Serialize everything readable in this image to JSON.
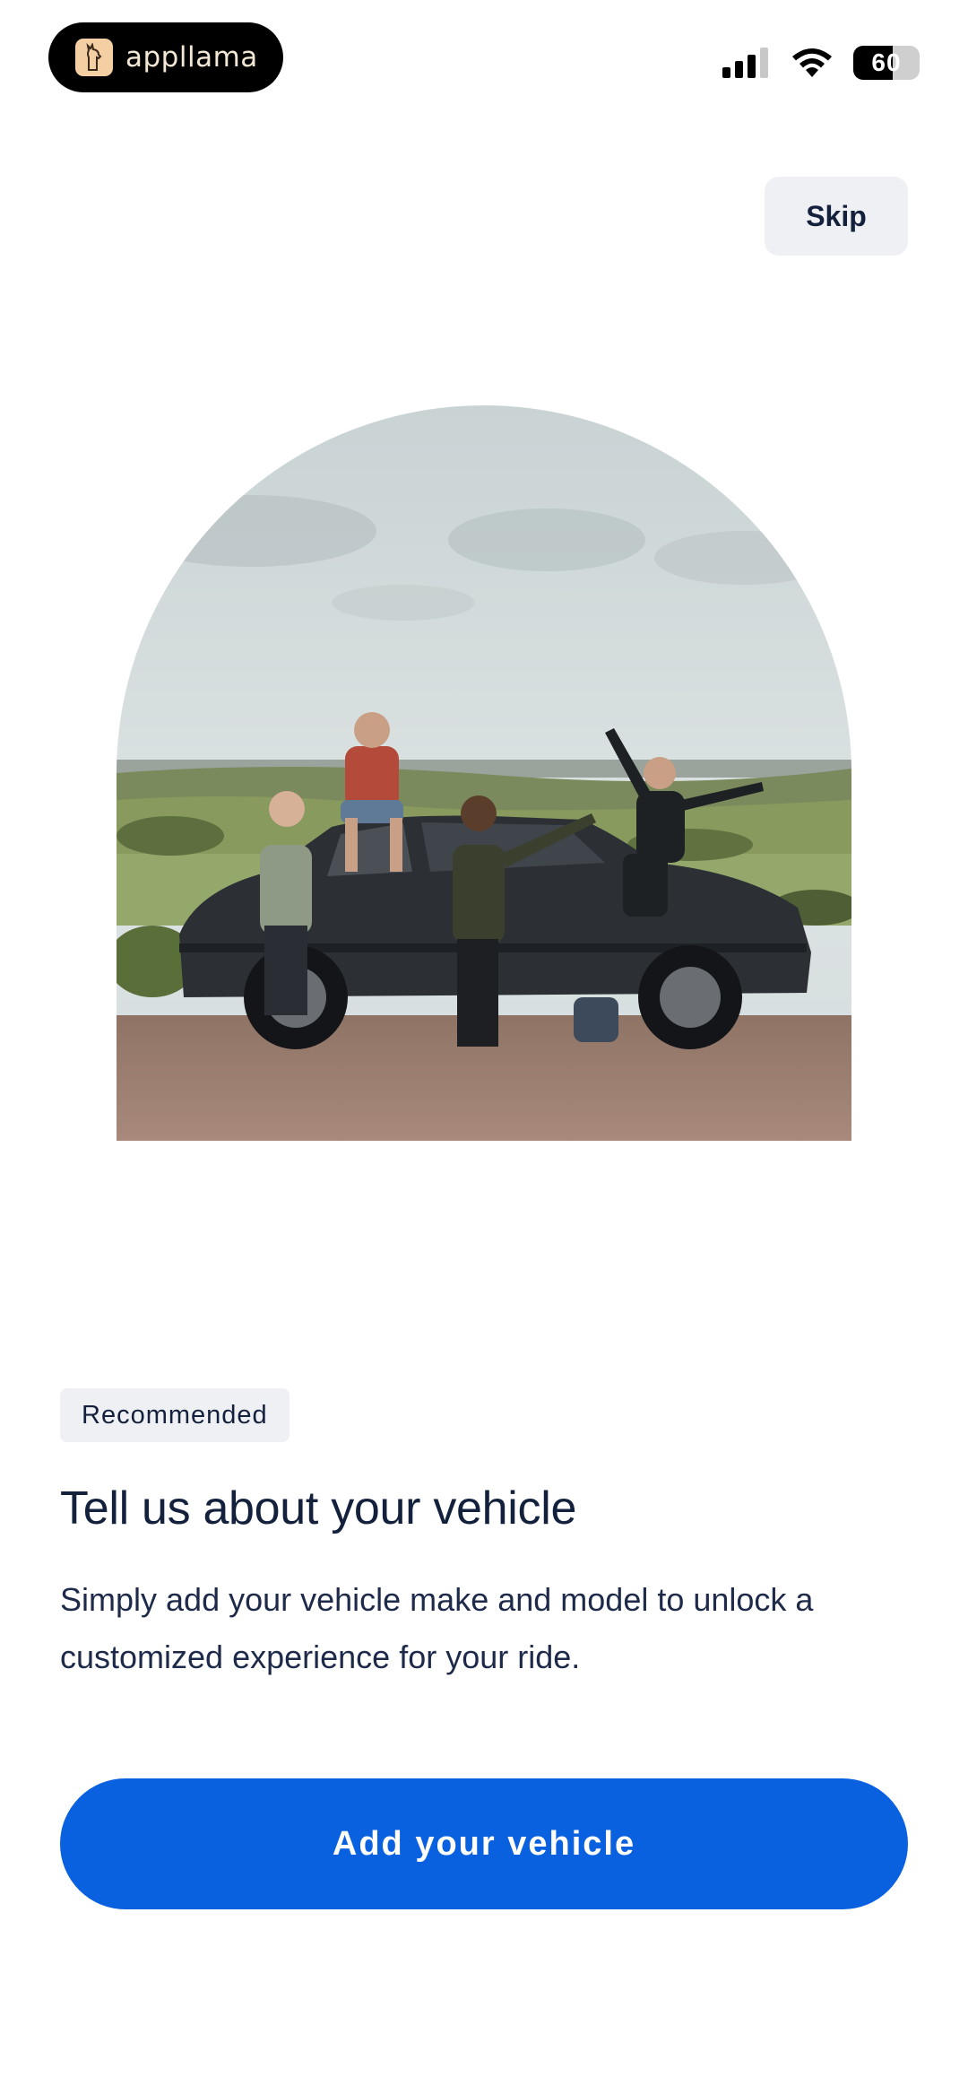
{
  "status_bar": {
    "app_name": "appllama",
    "battery_level": "60",
    "icons": [
      "cellular-signal-icon",
      "wifi-icon",
      "battery-icon"
    ]
  },
  "header": {
    "skip_label": "Skip"
  },
  "hero": {
    "image": "photo-people-posing-with-dark-suv-on-hill"
  },
  "content": {
    "badge": "Recommended",
    "title": "Tell us about your vehicle",
    "description": "Simply add your vehicle make and model to unlock a customized experience for your ride."
  },
  "actions": {
    "primary_label": "Add your vehicle"
  },
  "colors": {
    "primary": "#0961e0",
    "text": "#14213d",
    "muted_bg": "#eef0f3"
  }
}
